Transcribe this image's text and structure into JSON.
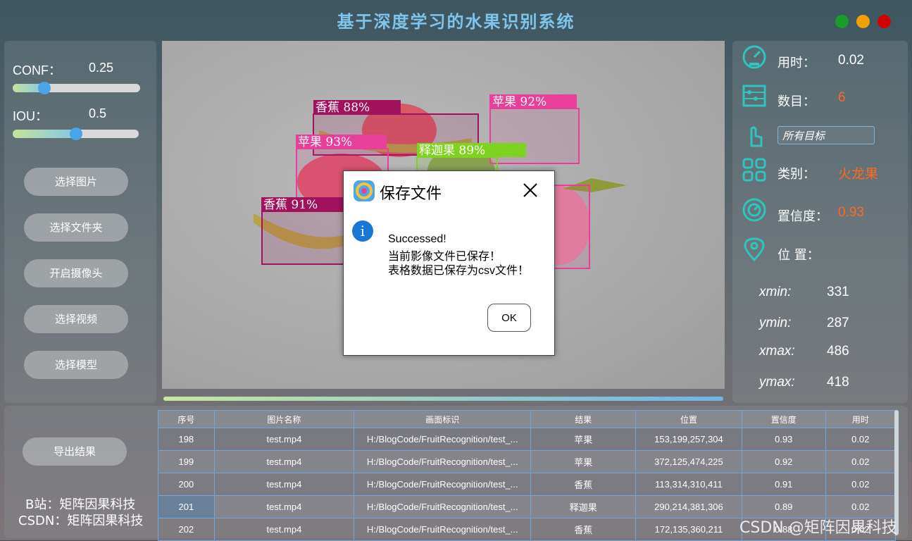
{
  "app": {
    "title": "基于深度学习的水果识别系统"
  },
  "window_controls": [
    {
      "name": "minimize-button",
      "color": "#1a9b2a"
    },
    {
      "name": "maximize-button",
      "color": "#f0a000"
    },
    {
      "name": "close-button",
      "color": "#d40000"
    }
  ],
  "params": {
    "conf_label": "CONF：",
    "conf_value": "0.25",
    "conf_level": 0.25,
    "iou_label": "IOU：",
    "iou_value": "0.5",
    "iou_level": 0.5
  },
  "buttons": {
    "select_image": "选择图片",
    "select_folder": "选择文件夹",
    "open_camera": "开启摄像头",
    "select_video": "选择视频",
    "select_model": "选择模型",
    "export": "导出结果"
  },
  "detections": [
    {
      "label": "香蕉 88%",
      "color": "#a0125e"
    },
    {
      "label": "苹果 92%",
      "color": "#e8409a"
    },
    {
      "label": "苹果 93%",
      "color": "#e8409a"
    },
    {
      "label": "释迦果 89%",
      "color": "#7ed321"
    },
    {
      "label": "香蕉 91%",
      "color": "#a0125e"
    }
  ],
  "progress": {
    "level": 1.0
  },
  "stats": {
    "time_label": "用时：",
    "time_value": "0.02",
    "count_label": "数目：",
    "count_value": "6",
    "target_select": "所有目标",
    "class_label": "类别：",
    "class_value": "火龙果",
    "conf_label": "置信度：",
    "conf_value": "0.93",
    "pos_label": "位 置：",
    "xmin_label": "xmin:",
    "xmin": "331",
    "ymin_label": "ymin:",
    "ymin": "287",
    "xmax_label": "xmax:",
    "xmax": "486",
    "ymax_label": "ymax:",
    "ymax": "418",
    "accent": "#ff6a1f"
  },
  "table": {
    "headers": [
      "序号",
      "图片名称",
      "画面标识",
      "结果",
      "位置",
      "置信度",
      "用时"
    ],
    "rows": [
      [
        "198",
        "test.mp4",
        "H:/BlogCode/FruitRecognition/test_...",
        "苹果",
        "153,199,257,304",
        "0.93",
        "0.02"
      ],
      [
        "199",
        "test.mp4",
        "H:/BlogCode/FruitRecognition/test_...",
        "苹果",
        "372,125,474,225",
        "0.92",
        "0.02"
      ],
      [
        "200",
        "test.mp4",
        "H:/BlogCode/FruitRecognition/test_...",
        "香蕉",
        "113,314,310,411",
        "0.91",
        "0.02"
      ],
      [
        "201",
        "test.mp4",
        "H:/BlogCode/FruitRecognition/test_...",
        "释迦果",
        "290,214,381,306",
        "0.89",
        "0.02"
      ],
      [
        "202",
        "test.mp4",
        "H:/BlogCode/FruitRecognition/test_...",
        "香蕉",
        "172,135,360,211",
        "0.88",
        "0.02"
      ]
    ]
  },
  "dialog": {
    "title": "保存文件",
    "line1": "Successed!",
    "line2": "当前影像文件已保存！",
    "line3": "表格数据已保存为csv文件！",
    "ok": "OK"
  },
  "footer": {
    "bilibili": "B站：矩阵因果科技",
    "csdn": "CSDN：矩阵因果科技",
    "watermark": "CSDN @矩阵因果科技"
  }
}
